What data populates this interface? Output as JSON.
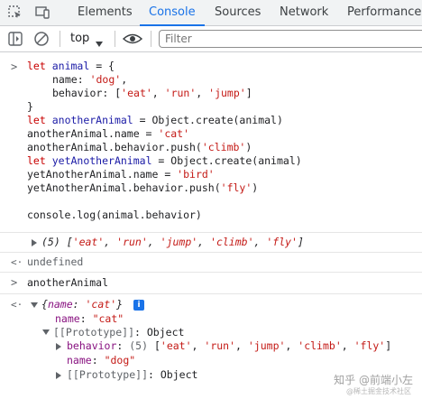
{
  "tabs": [
    {
      "label": "Elements",
      "active": false
    },
    {
      "label": "Console",
      "active": true
    },
    {
      "label": "Sources",
      "active": false
    },
    {
      "label": "Network",
      "active": false
    },
    {
      "label": "Performance",
      "active": false
    }
  ],
  "toolbar": {
    "context": "top",
    "filter_placeholder": "Filter"
  },
  "console": {
    "input1": {
      "l1_kw": "let",
      "l1_id": "animal",
      "l1_rest": " = {",
      "l2_prop": "name",
      "l2_str": "'dog'",
      "l3_prop": "behavior",
      "l3_s1": "'eat'",
      "l3_s2": "'run'",
      "l3_s3": "'jump'",
      "l4": "}",
      "l5_kw": "let",
      "l5_id": "anotherAnimal",
      "l5_rest": " = Object.create(animal)",
      "l6_pre": "anotherAnimal.name = ",
      "l6_str": "'cat'",
      "l7_pre": "anotherAnimal.behavior.push(",
      "l7_str": "'climb'",
      "l7_post": ")",
      "l8_kw": "let",
      "l8_id": "yetAnotherAnimal",
      "l8_rest": " = Object.create(animal)",
      "l9_pre": "yetAnotherAnimal.name = ",
      "l9_str": "'bird'",
      "l10_pre": "yetAnotherAnimal.behavior.push(",
      "l10_str": "'fly'",
      "l10_post": ")",
      "l11": "console.log(animal.behavior)"
    },
    "log1": {
      "count": "(5)",
      "items": [
        "'eat'",
        "'run'",
        "'jump'",
        "'climb'",
        "'fly'"
      ]
    },
    "result1": "undefined",
    "input2": "anotherAnimal",
    "result2": {
      "summary_prop": "name",
      "summary_val": "'cat'",
      "badge": "i",
      "name_key": "name",
      "name_val": "\"cat\"",
      "proto_label": "[[Prototype]]",
      "proto_type": "Object",
      "behavior_key": "behavior",
      "behavior_count": "(5)",
      "behavior_items": [
        "'eat'",
        "'run'",
        "'jump'",
        "'climb'",
        "'fly'"
      ],
      "inner_name_key": "name",
      "inner_name_val": "\"dog\"",
      "inner_proto_label": "[[Prototype]]",
      "inner_proto_type": "Object"
    }
  },
  "watermark": {
    "main": "知乎 @前端小左",
    "sub": "@稀土掘金技术社区"
  }
}
